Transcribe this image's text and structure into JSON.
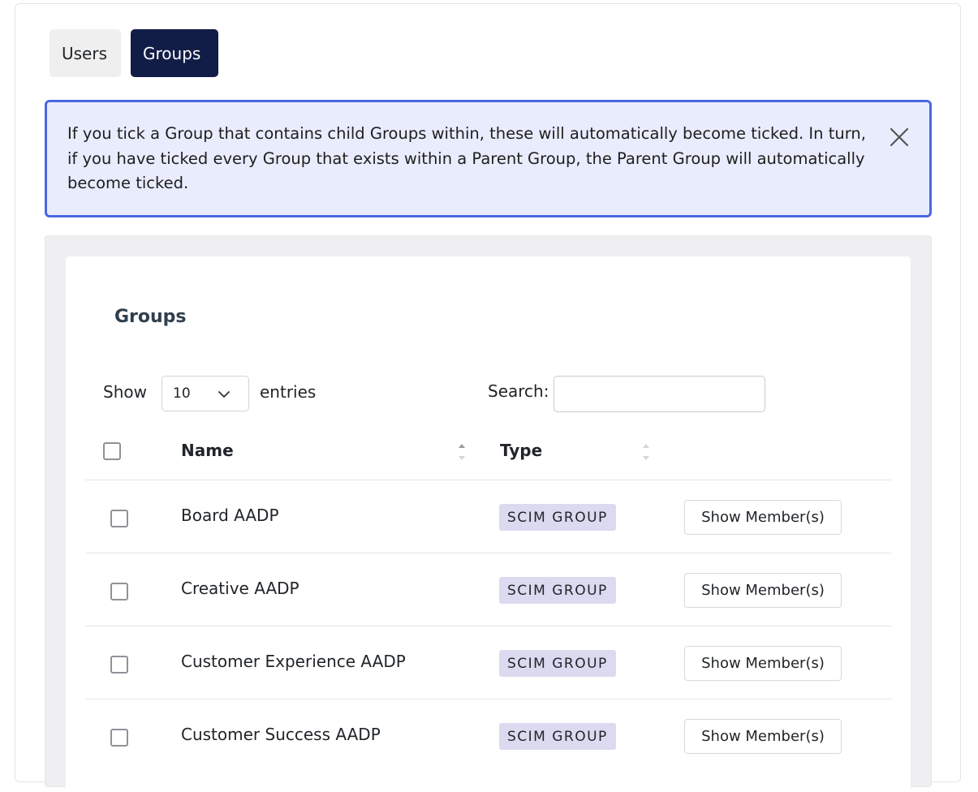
{
  "tabs": [
    {
      "label": "Users",
      "active": false
    },
    {
      "label": "Groups",
      "active": true
    }
  ],
  "alert": {
    "text": "If you tick a Group that contains child Groups within, these will automatically become ticked. In turn, if you have ticked every Group that exists within a Parent Group, the Parent Group will automatically become ticked.",
    "close_icon": "close-icon"
  },
  "card": {
    "title": "Groups"
  },
  "controls": {
    "show_label": "Show",
    "entries_value": "10",
    "entries_label": "entries",
    "search_label": "Search:",
    "search_value": ""
  },
  "table": {
    "columns": [
      "Name",
      "Type"
    ],
    "rows": [
      {
        "name": "Board AADP",
        "type": "SCIM GROUP",
        "action": "Show Member(s)"
      },
      {
        "name": "Creative AADP",
        "type": "SCIM GROUP",
        "action": "Show Member(s)"
      },
      {
        "name": "Customer Experience AADP",
        "type": "SCIM GROUP",
        "action": "Show Member(s)"
      },
      {
        "name": "Customer Success AADP",
        "type": "SCIM GROUP",
        "action": "Show Member(s)"
      }
    ]
  },
  "colors": {
    "active_tab": "#121d47",
    "alert_border": "#4a67e0",
    "alert_bg": "#e9ecfd",
    "badge_bg": "#dcdaf0"
  }
}
